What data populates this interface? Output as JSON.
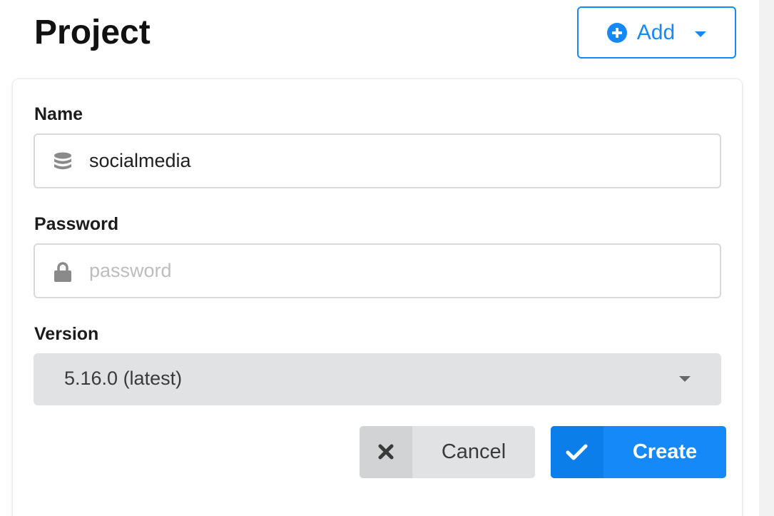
{
  "header": {
    "title": "Project",
    "add_button": {
      "label": "Add",
      "icon": "plus-circle-icon",
      "caret": "caret-down-icon"
    }
  },
  "form": {
    "name": {
      "label": "Name",
      "icon": "database-icon",
      "value": "socialmedia",
      "placeholder": ""
    },
    "password": {
      "label": "Password",
      "icon": "lock-icon",
      "value": "",
      "placeholder": "password"
    },
    "version": {
      "label": "Version",
      "selected": "5.16.0 (latest)",
      "caret": "caret-down-icon"
    },
    "actions": {
      "cancel": {
        "label": "Cancel",
        "icon": "x-icon"
      },
      "create": {
        "label": "Create",
        "icon": "check-icon"
      }
    }
  },
  "colors": {
    "accent": "#1489f7",
    "field_border": "#d9d9d9",
    "select_bg": "#e1e2e3",
    "icon_gray": "#8a8a8a"
  }
}
